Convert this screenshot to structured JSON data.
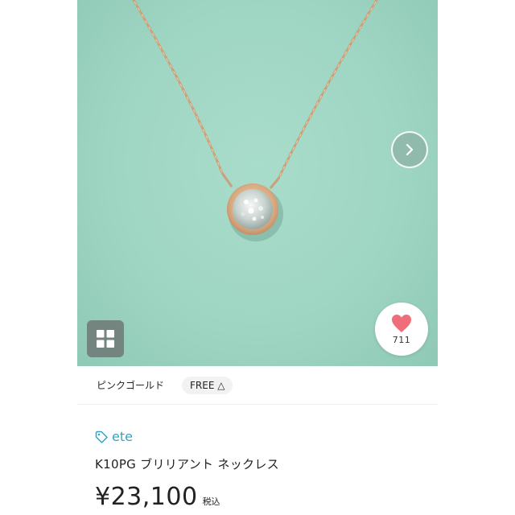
{
  "carousel": {
    "image_alt": "K10PG ブリリアント ネックレス",
    "next_icon": "chevron-right-icon",
    "grid_icon": "grid-icon"
  },
  "like": {
    "icon": "heart-icon",
    "count": "711",
    "color": "#ef6e7a"
  },
  "variant": {
    "color": "ピンクゴールド",
    "size": "FREE △"
  },
  "product": {
    "brand_icon": "tag-icon",
    "brand": "ete",
    "title": "K10PG ブリリアント ネックレス",
    "price": "¥23,100",
    "tax_label": "税込"
  },
  "colors": {
    "brand_accent": "#2fa5c5",
    "photo_background": "#a3d8c7"
  }
}
